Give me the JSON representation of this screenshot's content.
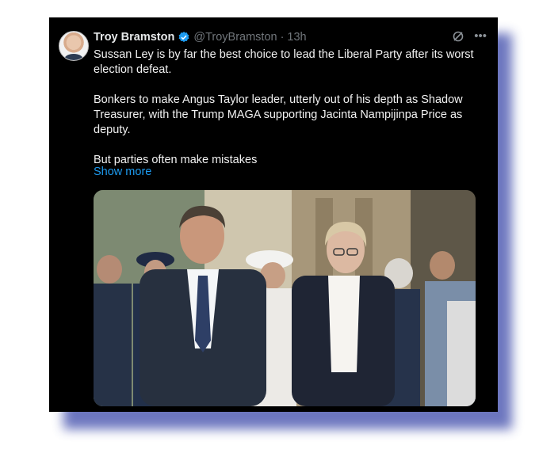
{
  "post": {
    "author_name": "Troy Bramston",
    "handle": "@TroyBramston",
    "separator": "·",
    "time": "13h",
    "paragraphs": [
      "Sussan Ley is by far the best choice to lead the Liberal Party after its worst\nelection defeat.",
      "Bonkers to make Angus Taylor leader, utterly out of his depth as Shadow\nTreasurer, with the Trump MAGA supporting Jacinta Nampijinpa Price as\ndeputy.",
      "But parties often make mistakes"
    ],
    "show_more": "Show more"
  },
  "icons": {
    "verified": "verified-badge-icon",
    "grok": "grok-icon",
    "more": "more-options-icon"
  },
  "colors": {
    "background": "#000000",
    "text": "#e7e9ea",
    "muted": "#71767b",
    "link": "#1d9bf0",
    "verified": "#1d9bf0",
    "frame_shadow": "#5d68b8"
  }
}
